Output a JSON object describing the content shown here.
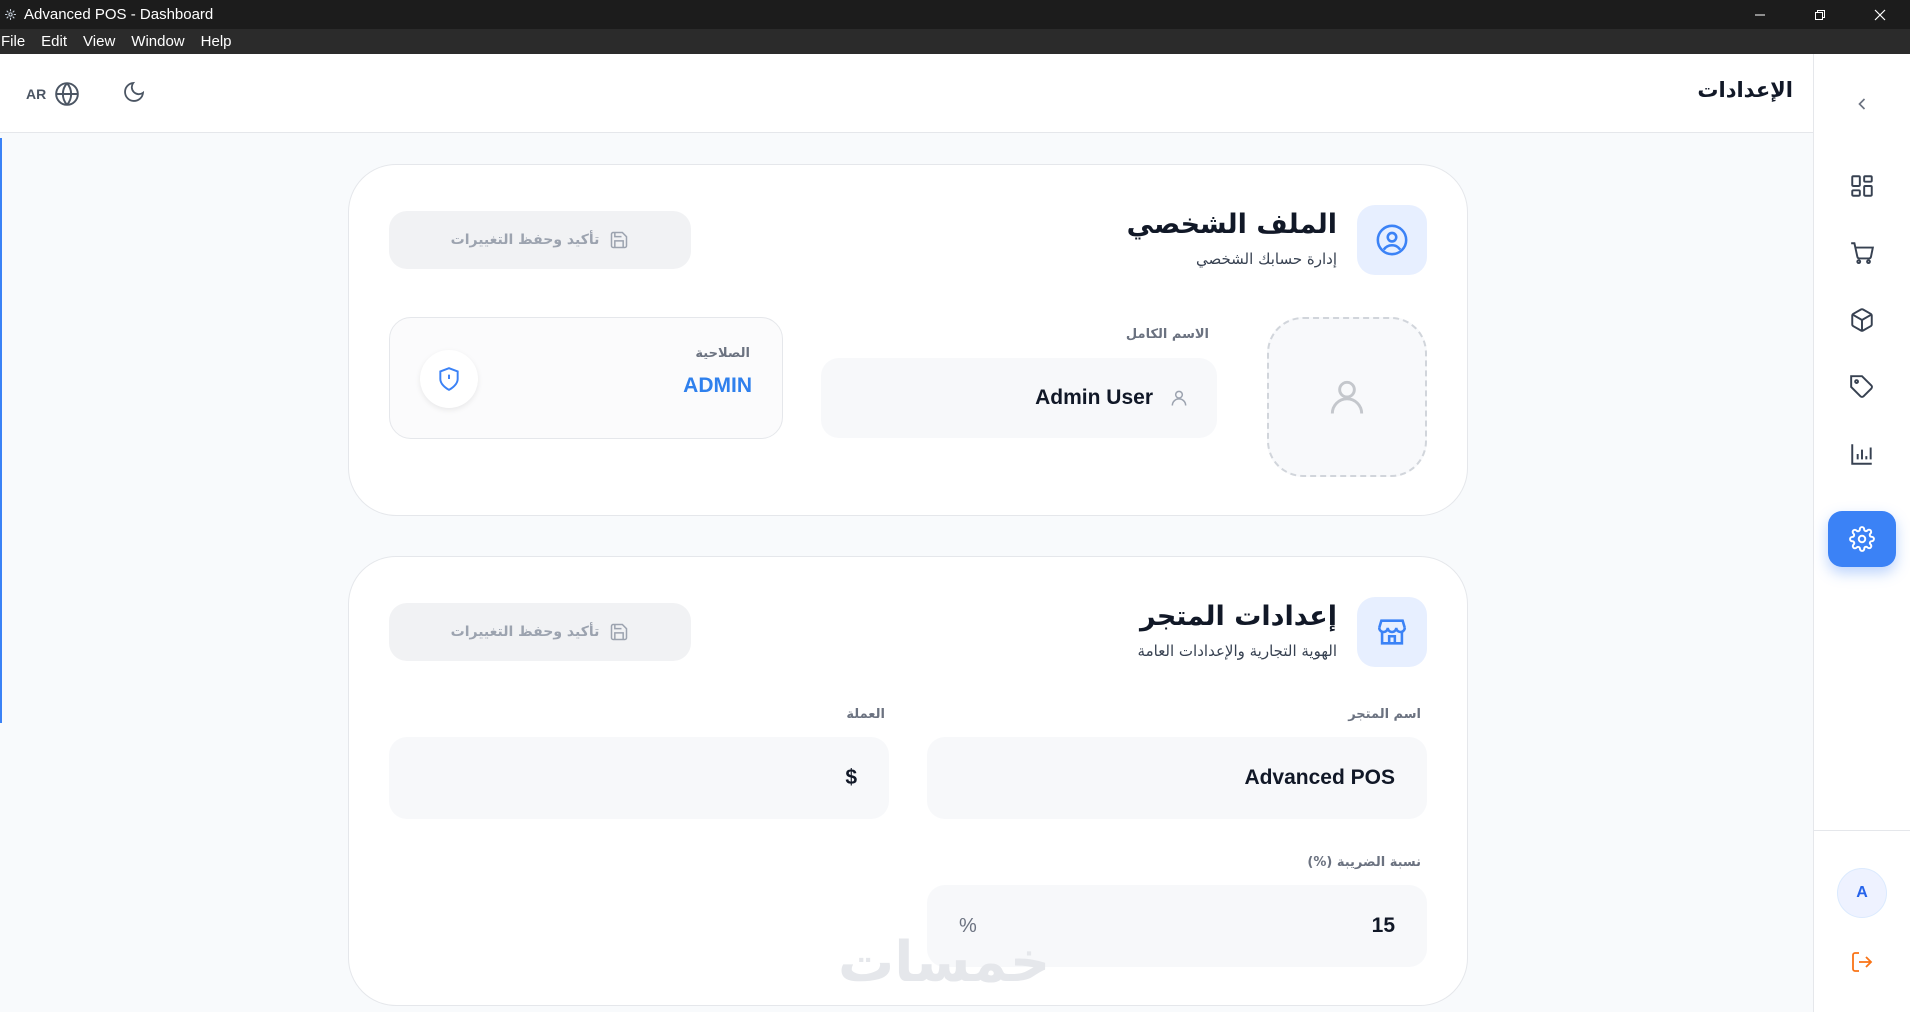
{
  "window": {
    "title": "Advanced POS - Dashboard"
  },
  "menu": [
    "File",
    "Edit",
    "View",
    "Window",
    "Help"
  ],
  "header": {
    "title": "الإعدادات",
    "language_label": "AR"
  },
  "sidebar": {
    "nav_icons": [
      "dashboard-icon",
      "cart-icon",
      "package-icon",
      "tag-icon",
      "chart-icon",
      "settings-icon"
    ],
    "active_item": "settings-icon",
    "user_initial": "A",
    "accent_color": "#3b82f6",
    "logout_color": "#f97316"
  },
  "profile": {
    "title": "الملف الشخصي",
    "subtitle": "إدارة حسابك الشخصي",
    "save_label": "تأكيد وحفظ التغييرات",
    "full_name_label": "الاسم الكامل",
    "full_name_value": "Admin User",
    "role_label": "الصلاحية",
    "role_value": "ADMIN"
  },
  "store": {
    "title": "إعدادات المتجر",
    "subtitle": "الهوية التجارية والإعدادات العامة",
    "save_label": "تأكيد وحفظ التغييرات",
    "store_name_label": "اسم المتجر",
    "store_name_value": "Advanced POS",
    "currency_label": "العملة",
    "currency_value": "$",
    "tax_label": "نسبة الضريبة (%)",
    "tax_value": "15",
    "tax_unit": "%"
  },
  "watermark": "خمسات"
}
